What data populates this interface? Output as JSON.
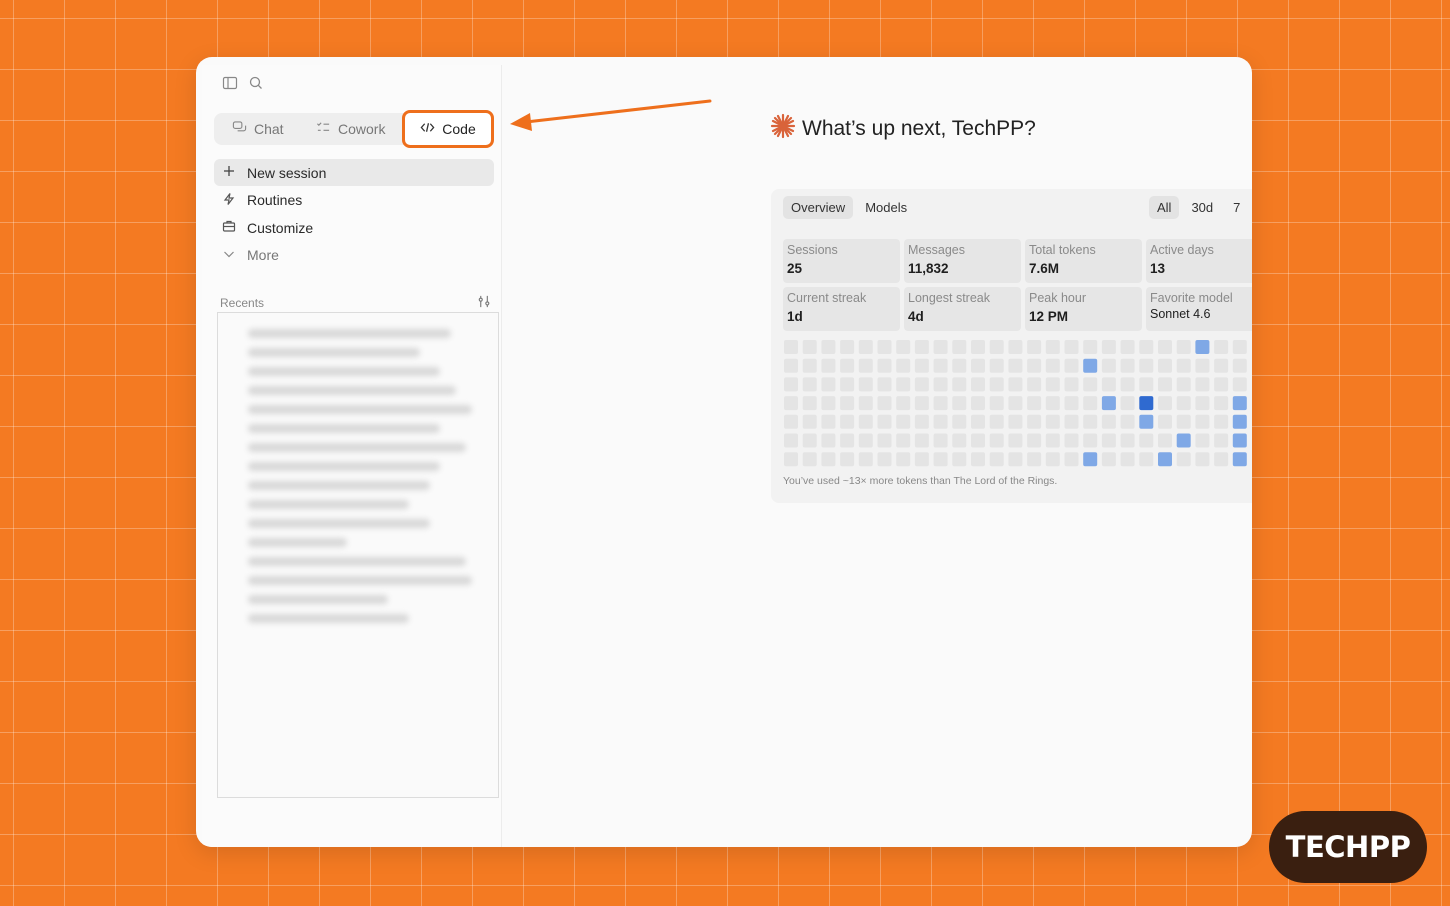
{
  "mode_switcher": {
    "chat": "Chat",
    "cowork": "Cowork",
    "code": "Code"
  },
  "nav": [
    {
      "label": "New session",
      "icon": "plus-icon"
    },
    {
      "label": "Routines",
      "icon": "bolt-icon"
    },
    {
      "label": "Customize",
      "icon": "briefcase-icon"
    },
    {
      "label": "More",
      "icon": "chevron-down-icon"
    }
  ],
  "recents": {
    "title": "Recents",
    "blurred_items": 16
  },
  "greeting": "What’s up next, TechPP?",
  "stats": {
    "tabs": [
      "Overview",
      "Models"
    ],
    "ranges": [
      "All",
      "30d",
      "7"
    ],
    "cards": [
      {
        "label": "Sessions",
        "value": "25"
      },
      {
        "label": "Messages",
        "value": "11,832"
      },
      {
        "label": "Total tokens",
        "value": "7.6M"
      },
      {
        "label": "Active days",
        "value": "13"
      },
      {
        "label": "Current streak",
        "value": "1d"
      },
      {
        "label": "Longest streak",
        "value": "4d"
      },
      {
        "label": "Peak hour",
        "value": "12 PM"
      },
      {
        "label": "Favorite model",
        "value": "Sonnet 4.6"
      }
    ],
    "heatmap": {
      "rows": 7,
      "columns": 25,
      "active_cells": [
        {
          "row": 0,
          "col": 22,
          "level": 1
        },
        {
          "row": 1,
          "col": 16,
          "level": 1
        },
        {
          "row": 3,
          "col": 17,
          "level": 1
        },
        {
          "row": 3,
          "col": 19,
          "level": 2
        },
        {
          "row": 3,
          "col": 24,
          "level": 1
        },
        {
          "row": 4,
          "col": 19,
          "level": 1
        },
        {
          "row": 4,
          "col": 24,
          "level": 1
        },
        {
          "row": 5,
          "col": 21,
          "level": 1
        },
        {
          "row": 5,
          "col": 24,
          "level": 1
        },
        {
          "row": 6,
          "col": 16,
          "level": 1
        },
        {
          "row": 6,
          "col": 20,
          "level": 1
        },
        {
          "row": 6,
          "col": 24,
          "level": 1
        }
      ],
      "colors": {
        "empty": "#e4e4e4",
        "level1": "#7fa8e6",
        "level2": "#2f6ad0"
      }
    },
    "footnote": "You’ve used ~13× more tokens than The Lord of the Rings."
  },
  "brand": "TECHPP",
  "accent_color": "#ee6f1c"
}
